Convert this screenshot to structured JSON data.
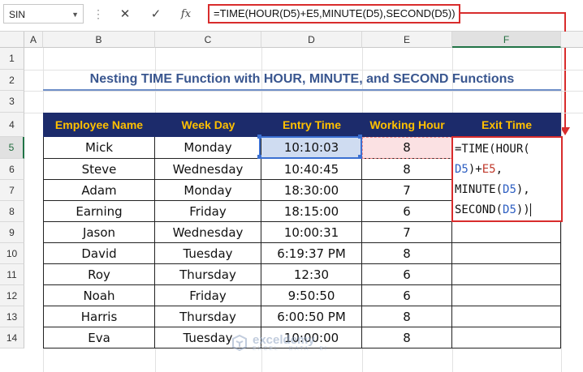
{
  "formula_bar": {
    "name_box": "SIN",
    "cancel_icon": "✕",
    "enter_icon": "✓",
    "fx_icon": "fx",
    "formula": "=TIME(HOUR(D5)+E5,MINUTE(D5),SECOND(D5))"
  },
  "columns": [
    "A",
    "B",
    "C",
    "D",
    "E",
    "F"
  ],
  "rows": [
    "1",
    "2",
    "3",
    "4",
    "5",
    "6",
    "7",
    "8",
    "9",
    "10",
    "11",
    "12",
    "13",
    "14"
  ],
  "title": "Nesting TIME Function with HOUR, MINUTE, and SECOND Functions",
  "table": {
    "headers": [
      "Employee Name",
      "Week Day",
      "Entry Time",
      "Working Hour",
      "Exit Time"
    ],
    "rows": [
      [
        "Mick",
        "Monday",
        "10:10:03",
        "8"
      ],
      [
        "Steve",
        "Wednesday",
        "10:40:45",
        "8"
      ],
      [
        "Adam",
        "Monday",
        "18:30:00",
        "7"
      ],
      [
        "Earning",
        "Friday",
        "18:15:00",
        "6"
      ],
      [
        "Jason",
        "Wednesday",
        "10:00:31",
        "7"
      ],
      [
        "David",
        "Tuesday",
        "6:19:37 PM",
        "8"
      ],
      [
        "Roy",
        "Thursday",
        "12:30",
        "6"
      ],
      [
        "Noah",
        "Friday",
        "9:50:50",
        "6"
      ],
      [
        "Harris",
        "Thursday",
        "6:00:50 PM",
        "8"
      ],
      [
        "Eva",
        "Tuesday",
        "10:00:00",
        "8"
      ]
    ]
  },
  "edit": {
    "l1": "=TIME(HOUR(",
    "l2a": "D5",
    "l2b": ")+",
    "l2c": "E5",
    "l2d": ",",
    "l3a": "MINUTE(",
    "l3b": "D5",
    "l3c": "),",
    "l4a": "SECOND(",
    "l4b": "D5",
    "l4c": "))"
  },
  "watermark": {
    "name": "exceldemy",
    "sub": "EXCEL · DATA · BI"
  },
  "colors": {
    "header_bg": "#1c2b6b",
    "header_text": "#ffc000",
    "title_text": "#39568f",
    "highlight": "#d82c2c",
    "selection": "#3a6fd1"
  }
}
